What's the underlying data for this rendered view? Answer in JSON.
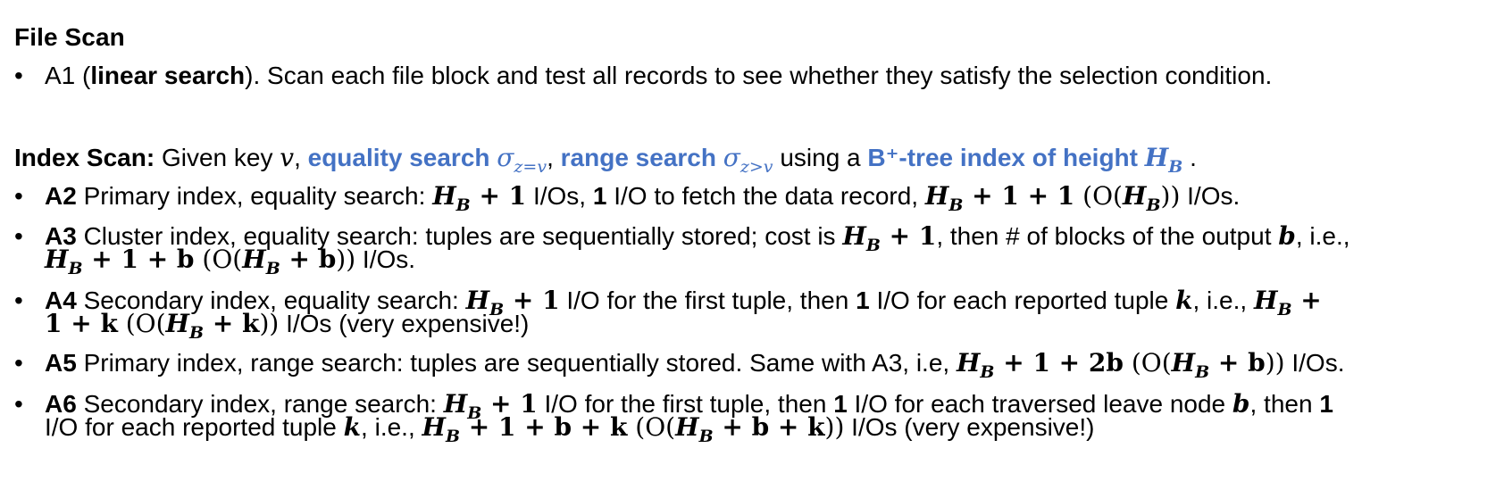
{
  "file_scan": {
    "heading": "File Scan",
    "a1": {
      "bullet": "•",
      "prefix": "A1 (",
      "bold": "linear search",
      "rest": ").  Scan each file block and test all records to see whether they satisfy the selection condition."
    }
  },
  "index_scan": {
    "label": "Index Scan:",
    "given_key": " Given key ",
    "v": "v",
    "comma1": ", ",
    "equality": "equality search ",
    "sigma": "σ",
    "eq_sub": "z=v",
    "comma2": ", ",
    "range": "range search ",
    "range_sub": "z>v",
    "using": " using a ",
    "btree": "B⁺-tree index of height ",
    "H": "H",
    "B": "B",
    "end": " ."
  },
  "items": {
    "a2": {
      "id": "A2",
      "text1": " Primary index, equality search: ",
      "expr1": "H",
      "sub": "B",
      "expr1b": " + 1",
      "text2": " I/Os, ",
      "one": "1",
      "text3": " I/O to fetch the data record, ",
      "expr2": "H",
      "expr2b": " + 1 + 1",
      "big_o": " (O(",
      "expr3": "H",
      "close": "))",
      "text4": " I/Os."
    },
    "a3": {
      "id": "A3",
      "line1": " Cluster index, equality search: tuples are sequentially stored; cost is ",
      "expr1": "H",
      "sub": "B",
      "expr1b": " + 1",
      "line1b": ", then # of blocks of the output ",
      "b": "b",
      "line1c": ", i.e.,",
      "line2_expr": "H",
      "line2_b": " + 1 + b",
      "line2_o": " (O(",
      "line2_h": "H",
      "line2_plus": " + b",
      "line2_close": "))",
      "line2_rest": " I/Os."
    },
    "a4": {
      "id": "A4",
      "line1": " Secondary index, equality search: ",
      "expr1": "H",
      "sub": "B",
      "expr1b": " + 1",
      "line1b": " I/O for the first tuple, then ",
      "one": "1",
      "line1c": " I/O for each reported tuple ",
      "k": "k",
      "line1d": ", i.e., ",
      "expr2": "H",
      "expr2b": " +",
      "line2_a": "1 + k",
      "line2_o": " (O(",
      "line2_h": "H",
      "line2_plus": " + k",
      "line2_close": "))",
      "line2_rest": " I/Os (very expensive!)"
    },
    "a5": {
      "id": "A5",
      "text1": " Primary index, range search: tuples are sequentially stored. Same with A3, i.e, ",
      "expr1": "H",
      "sub": "B",
      "expr1b": " + 1 + 2b",
      "big_o": " (O(",
      "expr2": "H",
      "plus": " + b",
      "close": "))",
      "text2": " I/Os."
    },
    "a6": {
      "id": "A6",
      "line1": " Secondary index, range search: ",
      "expr1": "H",
      "sub": "B",
      "expr1b": " + 1",
      "line1b": " I/O for the first tuple, then ",
      "one": "1",
      "line1c": " I/O for each traversed leave node ",
      "b": "b",
      "line1d": ", then ",
      "one2": "1",
      "line2_a": "I/O for each reported tuple ",
      "k": "k",
      "line2_b": ", i.e., ",
      "line2_h": "H",
      "line2_expr": " + 1 + b + k",
      "line2_o": " (O(",
      "line2_h2": "H",
      "line2_plus": " + b + k",
      "line2_close": "))",
      "line2_rest": " I/Os (very expensive!)"
    }
  },
  "colors": {
    "accent": "#4472C4",
    "text": "#000000"
  }
}
